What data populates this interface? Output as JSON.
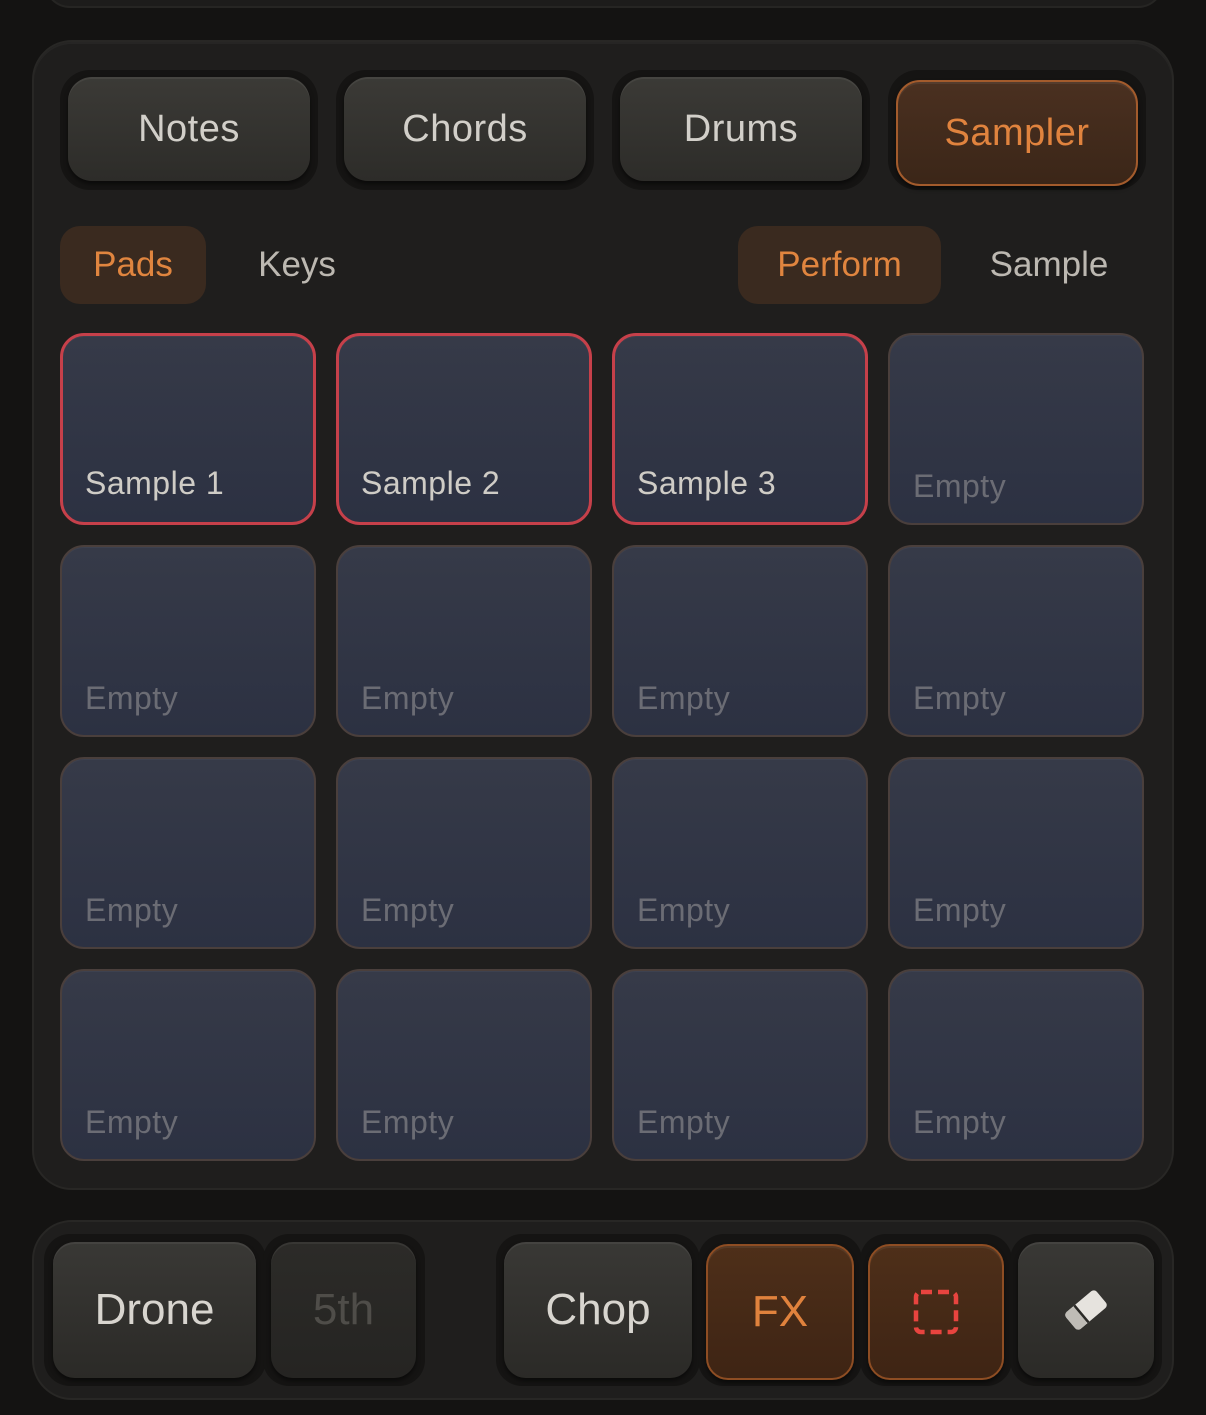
{
  "mode_tabs": [
    {
      "label": "Notes",
      "active": false
    },
    {
      "label": "Chords",
      "active": false
    },
    {
      "label": "Drums",
      "active": false
    },
    {
      "label": "Sampler",
      "active": true
    }
  ],
  "view_tabs": [
    {
      "label": "Pads",
      "active": true
    },
    {
      "label": "Keys",
      "active": false
    }
  ],
  "action_tabs": [
    {
      "label": "Perform",
      "active": true
    },
    {
      "label": "Sample",
      "active": false
    }
  ],
  "pads": [
    {
      "label": "Sample 1",
      "loaded": true
    },
    {
      "label": "Sample 2",
      "loaded": true
    },
    {
      "label": "Sample 3",
      "loaded": true
    },
    {
      "label": "Empty",
      "loaded": false
    },
    {
      "label": "Empty",
      "loaded": false
    },
    {
      "label": "Empty",
      "loaded": false
    },
    {
      "label": "Empty",
      "loaded": false
    },
    {
      "label": "Empty",
      "loaded": false
    },
    {
      "label": "Empty",
      "loaded": false
    },
    {
      "label": "Empty",
      "loaded": false
    },
    {
      "label": "Empty",
      "loaded": false
    },
    {
      "label": "Empty",
      "loaded": false
    },
    {
      "label": "Empty",
      "loaded": false
    },
    {
      "label": "Empty",
      "loaded": false
    },
    {
      "label": "Empty",
      "loaded": false
    },
    {
      "label": "Empty",
      "loaded": false
    }
  ],
  "toolbar": {
    "drone_label": "Drone",
    "fifth_label": "5th",
    "chop_label": "Chop",
    "fx_label": "FX",
    "select_icon": "dashed-selection-icon",
    "eraser_icon": "eraser-icon"
  },
  "colors": {
    "accent_orange": "#e0833e",
    "loaded_pad_border": "#c6404a",
    "pad_fill": "#303545",
    "background": "#141312"
  }
}
